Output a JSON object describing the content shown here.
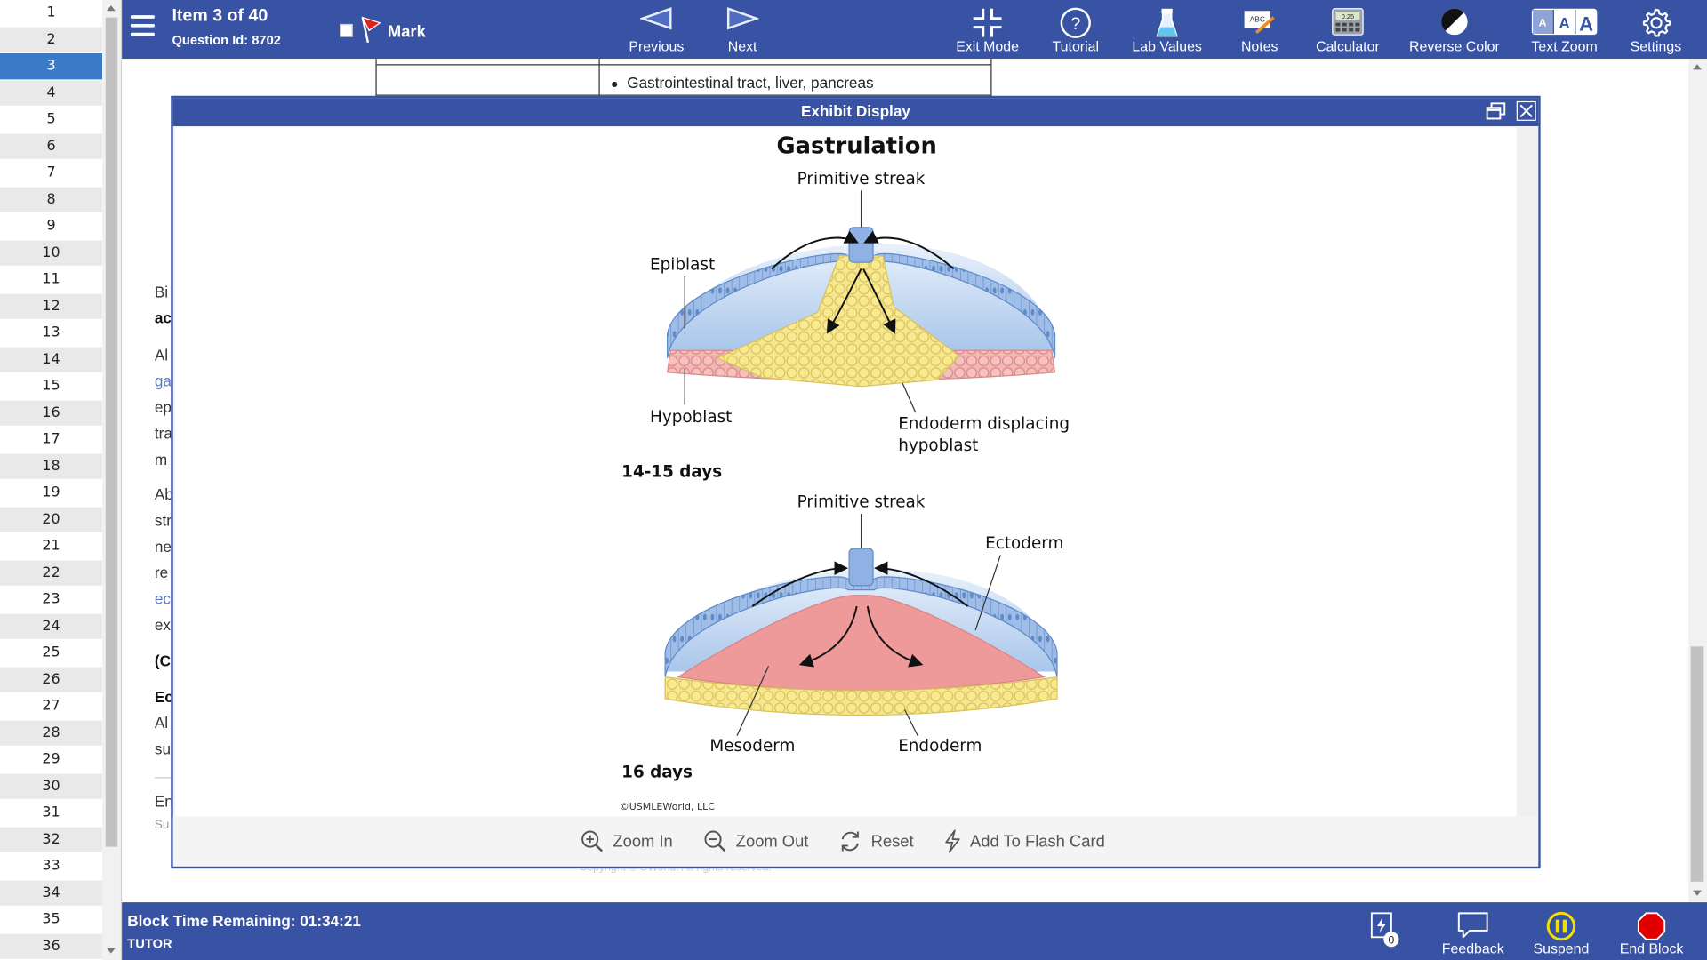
{
  "question_list": {
    "items": [
      "1",
      "2",
      "3",
      "4",
      "5",
      "6",
      "7",
      "8",
      "9",
      "10",
      "11",
      "12",
      "13",
      "14",
      "15",
      "16",
      "17",
      "18",
      "19",
      "20",
      "21",
      "22",
      "23",
      "24",
      "25",
      "26",
      "27",
      "28",
      "29",
      "30",
      "31",
      "32",
      "33",
      "34",
      "35",
      "36"
    ],
    "active": "3"
  },
  "topbar": {
    "item_title": "Item 3 of 40",
    "question_id": "Question Id: 8702",
    "mark_label": "Mark",
    "previous_label": "Previous",
    "next_label": "Next",
    "exit_mode_label": "Exit Mode",
    "tutorial_label": "Tutorial",
    "lab_values_label": "Lab Values",
    "notes_label": "Notes",
    "calculator_label": "Calculator",
    "calculator_display": "0.25",
    "reverse_color_label": "Reverse Color",
    "text_zoom_label": "Text Zoom",
    "text_zoom_letters": [
      "A",
      "A",
      "A"
    ],
    "notes_icon_text": "ABC",
    "settings_label": "Settings"
  },
  "background": {
    "table_cell": "Gastrointestinal tract, liver, pancreas",
    "fragments": [
      {
        "text": "Bi",
        "style": "normal"
      },
      {
        "text": "ac",
        "style": "bold"
      },
      {
        "text": "Al",
        "style": "normal"
      },
      {
        "text": "ga",
        "style": "link"
      },
      {
        "text": "ep",
        "style": "normal"
      },
      {
        "text": "tra",
        "style": "normal"
      },
      {
        "text": "m",
        "style": "normal"
      },
      {
        "text": "Ab",
        "style": "normal"
      },
      {
        "text": "str",
        "style": "normal"
      },
      {
        "text": "ne",
        "style": "normal"
      },
      {
        "text": "re",
        "style": "normal"
      },
      {
        "text": "ec",
        "style": "link"
      },
      {
        "text": "ex",
        "style": "normal"
      },
      {
        "text": "(C",
        "style": "bold"
      },
      {
        "text": "Ec",
        "style": "bold"
      },
      {
        "text": "Al",
        "style": "normal"
      },
      {
        "text": "su",
        "style": "normal"
      },
      {
        "text": "En",
        "style": "normal"
      },
      {
        "text": "Su",
        "style": "small"
      }
    ],
    "copyright": "Copyright © UWorld. All rights reserved."
  },
  "exhibit": {
    "header": "Exhibit Display",
    "figure": {
      "title": "Gastrulation",
      "top_panel": {
        "primitive_streak": "Primitive streak",
        "epiblast": "Epiblast",
        "hypoblast": "Hypoblast",
        "endoderm_line1": "Endoderm displacing",
        "endoderm_line2": "hypoblast",
        "stage": "14-15 days"
      },
      "bottom_panel": {
        "primitive_streak": "Primitive streak",
        "ectoderm": "Ectoderm",
        "mesoderm": "Mesoderm",
        "endoderm": "Endoderm",
        "stage": "16 days"
      },
      "copyright": "©USMLEWorld, LLC"
    },
    "footer": {
      "zoom_in": "Zoom In",
      "zoom_out": "Zoom Out",
      "reset": "Reset",
      "add_flash_card": "Add To Flash Card"
    }
  },
  "bottombar": {
    "time_remaining": "Block Time Remaining: 01:34:21",
    "mode": "TUTOR",
    "flash_count": "0",
    "feedback_label": "Feedback",
    "suspend_label": "Suspend",
    "end_block_label": "End Block"
  },
  "colors": {
    "brand_blue": "#3852a4",
    "active_item": "#3b7ac6",
    "suspend": "#f0e000",
    "end_block": "#e00000",
    "ectoderm": "#a9c6ea",
    "endoderm": "#f7e793",
    "mesoderm": "#ef9a9a",
    "hypoblast": "#f3b7b5"
  }
}
